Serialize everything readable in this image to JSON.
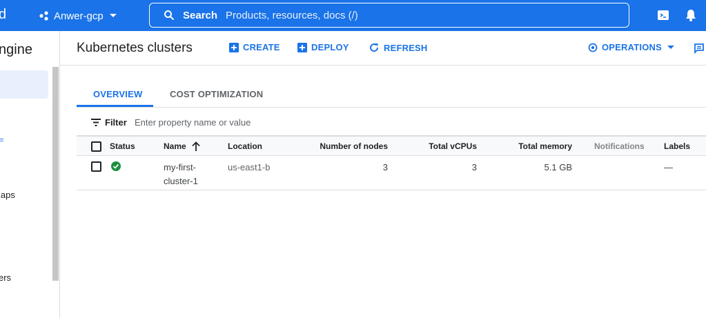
{
  "topbar": {
    "brand_fragment": "d",
    "project_name": "Anwer-gcp",
    "search_label": "Search",
    "search_placeholder": "Products, resources, docs (/)"
  },
  "sidebar": {
    "title_fragment": "ngine",
    "mark_fragment": "=",
    "items": [
      {
        "label": "laps"
      },
      {
        "label": "ers"
      }
    ]
  },
  "header": {
    "title": "Kubernetes clusters",
    "actions": {
      "create": "CREATE",
      "deploy": "DEPLOY",
      "refresh": "REFRESH",
      "operations": "OPERATIONS"
    }
  },
  "tabs": [
    {
      "label": "OVERVIEW",
      "active": true
    },
    {
      "label": "COST OPTIMIZATION",
      "active": false
    }
  ],
  "filter": {
    "label": "Filter",
    "placeholder": "Enter property name or value"
  },
  "table": {
    "columns": {
      "status": "Status",
      "name": "Name",
      "location": "Location",
      "nodes": "Number of nodes",
      "vcpus": "Total vCPUs",
      "memory": "Total memory",
      "notifications": "Notifications",
      "labels": "Labels"
    },
    "rows": [
      {
        "status": "ok",
        "name_line1": "my-first-",
        "name_line2": "cluster-1",
        "location": "us-east1-b",
        "nodes": "3",
        "vcpus": "3",
        "memory": "5.1 GB",
        "notifications": "",
        "labels": "—"
      }
    ]
  },
  "colors": {
    "brand_blue": "#1a73e8",
    "status_green": "#1e8e3e"
  },
  "icons": [
    "project-icon",
    "search-icon",
    "cloud-shell-icon",
    "notifications-bell-icon",
    "add-box-icon",
    "refresh-icon",
    "operations-icon",
    "feedback-icon",
    "filter-icon",
    "sort-arrow-up-icon",
    "check-circle-icon"
  ]
}
